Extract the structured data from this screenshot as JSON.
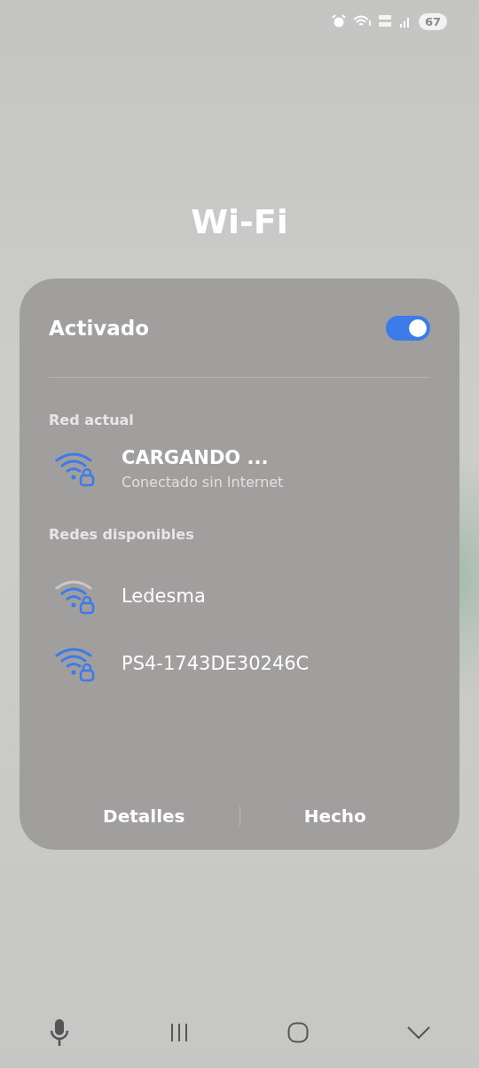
{
  "status_bar": {
    "battery": "67"
  },
  "title": "Wi-Fi",
  "panel": {
    "toggle": {
      "label": "Activado",
      "on": true
    },
    "current_section": "Red actual",
    "current": {
      "name": "CARGANDO ...",
      "status": "Conectado sin Internet",
      "kind": "full"
    },
    "available_section": "Redes disponibles",
    "networks": [
      {
        "name": "Ledesma",
        "kind": "weak"
      },
      {
        "name": "PS4-1743DE30246C",
        "kind": "full"
      }
    ],
    "buttons": [
      "Detalles",
      "Hecho"
    ]
  }
}
